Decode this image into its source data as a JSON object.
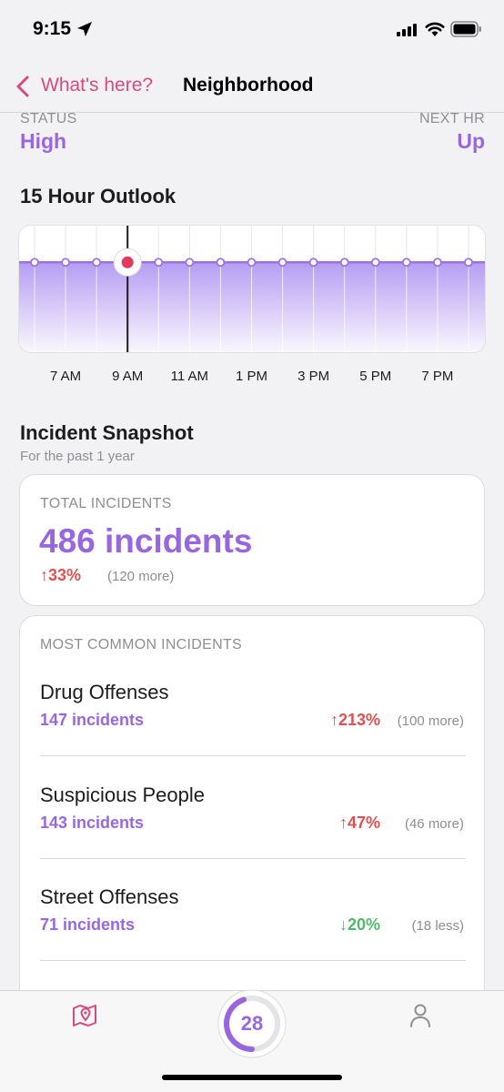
{
  "status_bar": {
    "time": "9:15"
  },
  "nav": {
    "back_label": "What's here?",
    "title": "Neighborhood"
  },
  "summary": {
    "status_label": "STATUS",
    "status_value": "High",
    "next_label": "NEXT HR",
    "next_value": "Up"
  },
  "outlook": {
    "title": "15 Hour Outlook",
    "chart_data": {
      "type": "area",
      "title": "15 Hour Outlook",
      "x": [
        "6 AM",
        "7 AM",
        "8 AM",
        "9 AM",
        "10 AM",
        "11 AM",
        "12 PM",
        "1 PM",
        "2 PM",
        "3 PM",
        "4 PM",
        "5 PM",
        "6 PM",
        "7 PM",
        "8 PM"
      ],
      "tick_labels": [
        "7 AM",
        "9 AM",
        "11 AM",
        "1 PM",
        "3 PM",
        "5 PM",
        "7 PM"
      ],
      "values": [
        1,
        1,
        1,
        1,
        1,
        1,
        1,
        1,
        1,
        1,
        1,
        1,
        1,
        1,
        1
      ],
      "current_index": 3,
      "ylim": [
        0,
        1.4
      ],
      "grid": true,
      "line_color": "#9a72e6",
      "fill_color": "#a88cf0",
      "marker_color": "#e03a62"
    }
  },
  "snapshot": {
    "title": "Incident Snapshot",
    "subtitle": "For the past 1 year",
    "total": {
      "label": "TOTAL INCIDENTS",
      "value": "486 incidents",
      "change": "↑33%",
      "detail": "(120 more)"
    },
    "common": {
      "label": "MOST COMMON INCIDENTS",
      "items": [
        {
          "name": "Drug Offenses",
          "count": "147 incidents",
          "change": "↑213%",
          "detail": "(100 more)"
        },
        {
          "name": "Suspicious People",
          "count": "143 incidents",
          "change": "↑47%",
          "detail": "(46 more)"
        },
        {
          "name": "Street Offenses",
          "count": "71 incidents",
          "change": "↓20%",
          "detail": "(18 less)"
        }
      ]
    }
  },
  "tab_bar": {
    "score": "28",
    "left_icon": "map-pin-icon",
    "right_icon": "person-icon"
  },
  "colors": {
    "accent": "#9867e0",
    "brand_pink": "#d64b7e",
    "up": "#e05050",
    "down": "#52b96a"
  }
}
